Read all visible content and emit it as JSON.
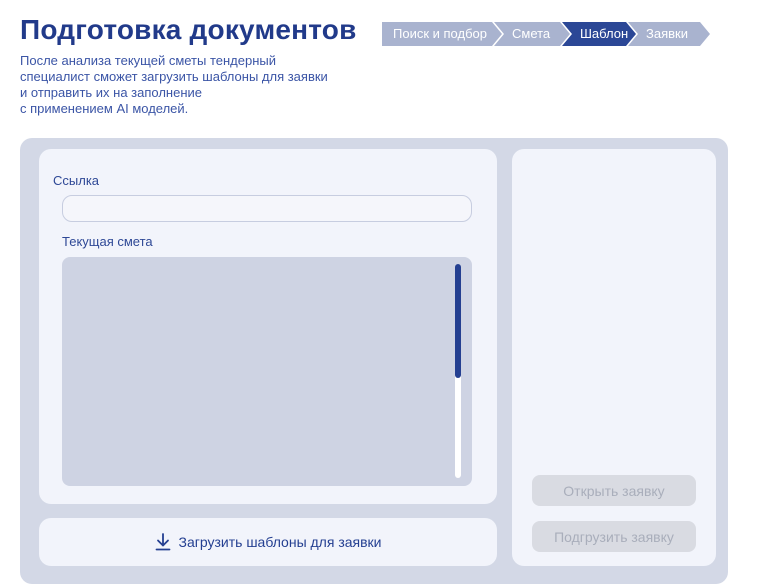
{
  "header": {
    "title": "Подготовка документов",
    "subtitle": "После анализа текущей сметы тендерный\nспециалист сможет загрузить шаблоны для заявки\nи отправить их на заполнение\nс применением AI моделей."
  },
  "steps": [
    {
      "label": "Поиск и подбор",
      "active": false
    },
    {
      "label": "Смета",
      "active": false
    },
    {
      "label": "Шаблон",
      "active": true
    },
    {
      "label": "Заявки",
      "active": false
    }
  ],
  "form": {
    "link_label": "Ссылка",
    "link_value": "",
    "estimate_label": "Текущая смета"
  },
  "upload_button": {
    "label": "Загрузить шаблоны для заявки",
    "icon": "download-icon"
  },
  "right_panel": {
    "open_button": "Открыть заявку",
    "load_button": "Подгрузить заявку"
  },
  "colors": {
    "accent": "#2b4796",
    "inactive_step": "#a9b3cf",
    "panel": "#d3d8e6",
    "card": "#f2f4fb"
  }
}
